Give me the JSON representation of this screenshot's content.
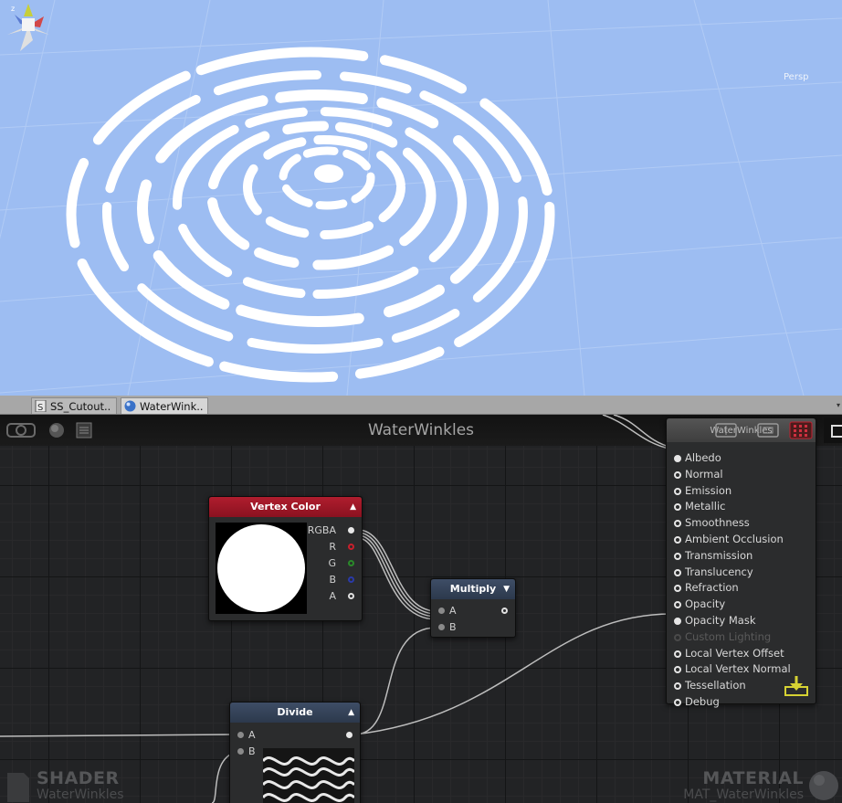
{
  "scene": {
    "view_label": "Persp",
    "gizmo_icon": "axis-gizmo-icon",
    "background_color": "#9dbdf2"
  },
  "tabs": [
    {
      "label": "SS_Cutout..",
      "icon": "shader-file-icon"
    },
    {
      "label": "WaterWink..",
      "icon": "material-sphere-icon"
    }
  ],
  "graph": {
    "title": "WaterWinkles",
    "toolbar_icons": [
      "camera-icon",
      "sphere-preview-icon",
      "notes-icon"
    ]
  },
  "nodes": {
    "vertex_color": {
      "title": "Vertex Color",
      "outputs": [
        "RGBA",
        "R",
        "G",
        "B",
        "A"
      ],
      "output_colors": [
        "#e8e8e8",
        "#c8202c",
        "#2a8a2a",
        "#2a3aa8",
        "#e0e0e0"
      ]
    },
    "multiply": {
      "title": "Multiply",
      "inputs": [
        "A",
        "B"
      ]
    },
    "divide": {
      "title": "Divide",
      "inputs": [
        "A",
        "B"
      ]
    },
    "master": {
      "title": "WaterWinkles",
      "ports": [
        {
          "label": "Albedo",
          "state": "connected"
        },
        {
          "label": "Normal",
          "state": "open"
        },
        {
          "label": "Emission",
          "state": "open"
        },
        {
          "label": "Metallic",
          "state": "open"
        },
        {
          "label": "Smoothness",
          "state": "open"
        },
        {
          "label": "Ambient Occlusion",
          "state": "open"
        },
        {
          "label": "Transmission",
          "state": "open"
        },
        {
          "label": "Translucency",
          "state": "open"
        },
        {
          "label": "Refraction",
          "state": "open"
        },
        {
          "label": "Opacity",
          "state": "open"
        },
        {
          "label": "Opacity Mask",
          "state": "connected"
        },
        {
          "label": "Custom Lighting",
          "state": "disabled"
        },
        {
          "label": "Local Vertex Offset",
          "state": "open"
        },
        {
          "label": "Local Vertex Normal",
          "state": "open"
        },
        {
          "label": "Tessellation",
          "state": "open"
        },
        {
          "label": "Debug",
          "state": "open"
        }
      ]
    }
  },
  "corners": {
    "shader_label": "SHADER",
    "shader_name": "WaterWinkles",
    "material_label": "MATERIAL",
    "material_name": "MAT_WaterWinkles"
  },
  "accent_colors": {
    "vertex_color_header": "#b01d2e",
    "math_header": "#3e4d66",
    "save_icon": "#d6d233"
  }
}
